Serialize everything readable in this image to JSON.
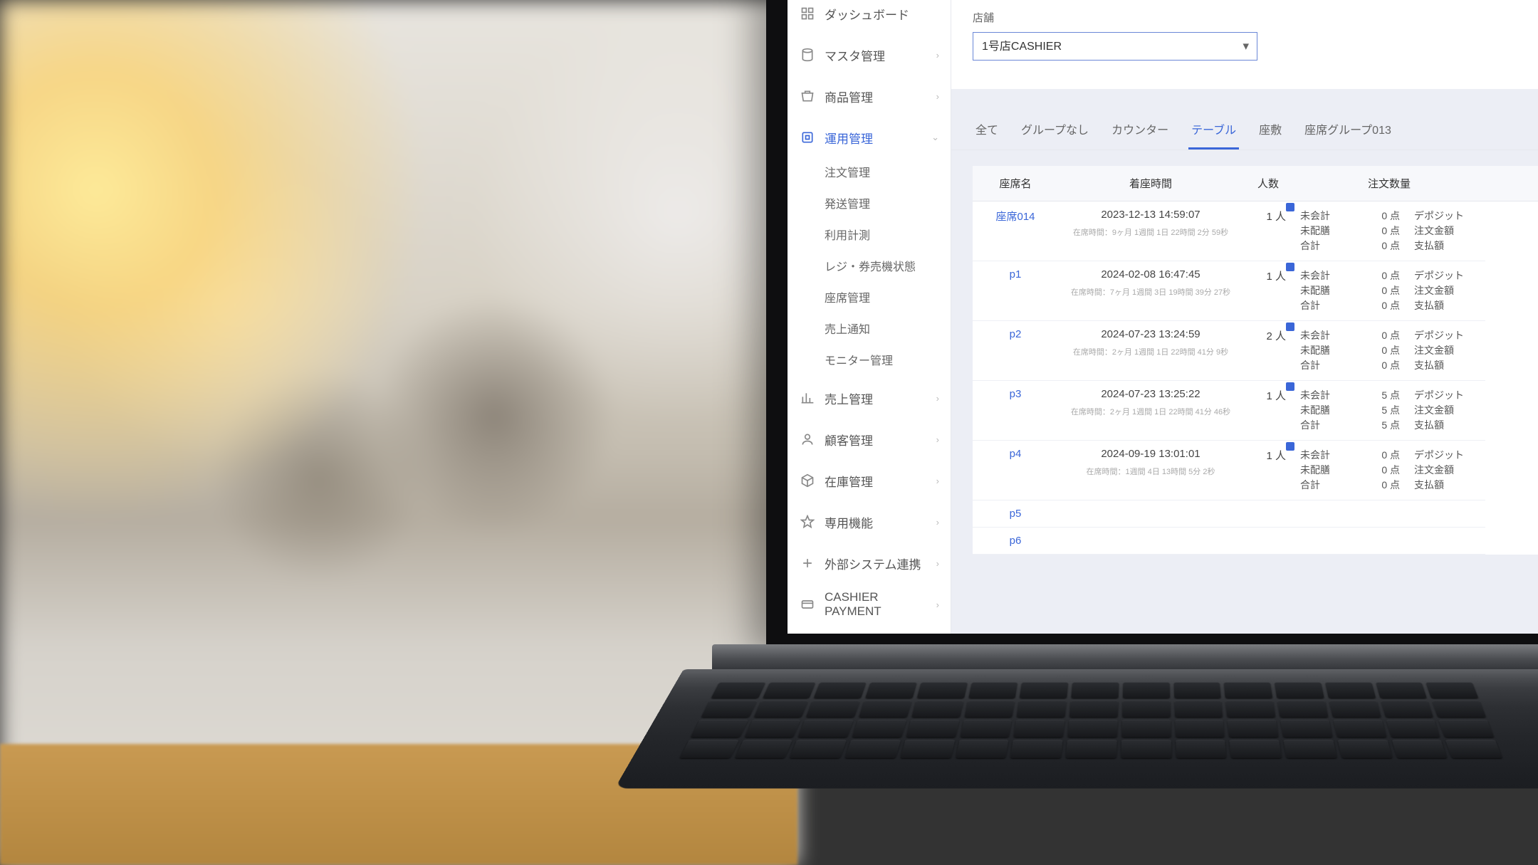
{
  "sidebar": {
    "items": [
      {
        "label": "ダッシュボード",
        "icon": "dashboard"
      },
      {
        "label": "マスタ管理",
        "icon": "master",
        "chev": true
      },
      {
        "label": "商品管理",
        "icon": "product",
        "chev": true
      },
      {
        "label": "運用管理",
        "icon": "operations",
        "chev": true,
        "active": true
      },
      {
        "label": "売上管理",
        "icon": "sales",
        "chev": true
      },
      {
        "label": "顧客管理",
        "icon": "customer",
        "chev": true
      },
      {
        "label": "在庫管理",
        "icon": "stock",
        "chev": true
      },
      {
        "label": "専用機能",
        "icon": "special",
        "chev": true
      },
      {
        "label": "外部システム連携",
        "icon": "external",
        "chev": true
      },
      {
        "label": "CASHIER PAYMENT",
        "icon": "payment",
        "chev": true
      }
    ],
    "operations_sub": [
      "注文管理",
      "発送管理",
      "利用計測",
      "レジ・券売機状態",
      "座席管理",
      "売上通知",
      "モニター管理"
    ]
  },
  "filter": {
    "label": "店舗",
    "selected": "1号店CASHIER"
  },
  "tabs": [
    "全て",
    "グループなし",
    "カウンター",
    "テーブル",
    "座敷",
    "座席グループ013"
  ],
  "active_tab": "テーブル",
  "table": {
    "headers": {
      "seat": "座席名",
      "seated_at": "着座時間",
      "people": "人数",
      "orders": "注文数量"
    },
    "order_labels": {
      "unpaid": "未会計",
      "undelivered": "未配膳",
      "total": "合計"
    },
    "unit": "点",
    "extra_labels": {
      "deposit": "デポジット",
      "order_amount": "注文金額",
      "pay_amount": "支払額"
    },
    "rows": [
      {
        "seat": "座席014",
        "time": "2023-12-13 14:59:07",
        "elapsed": "在席時間：9ヶ月 1週間 1日 22時間 2分 59秒",
        "people": "1 人",
        "unpaid": "0",
        "undelivered": "0",
        "total": "0"
      },
      {
        "seat": "p1",
        "time": "2024-02-08 16:47:45",
        "elapsed": "在席時間：7ヶ月 1週間 3日 19時間 39分 27秒",
        "people": "1 人",
        "unpaid": "0",
        "undelivered": "0",
        "total": "0"
      },
      {
        "seat": "p2",
        "time": "2024-07-23 13:24:59",
        "elapsed": "在席時間：2ヶ月 1週間 1日 22時間 41分 9秒",
        "people": "2 人",
        "unpaid": "0",
        "undelivered": "0",
        "total": "0"
      },
      {
        "seat": "p3",
        "time": "2024-07-23 13:25:22",
        "elapsed": "在席時間：2ヶ月 1週間 1日 22時間 41分 46秒",
        "people": "1 人",
        "unpaid": "5",
        "undelivered": "5",
        "total": "5"
      },
      {
        "seat": "p4",
        "time": "2024-09-19 13:01:01",
        "elapsed": "在席時間：1週間 4日 13時間 5分 2秒",
        "people": "1 人",
        "unpaid": "0",
        "undelivered": "0",
        "total": "0"
      },
      {
        "seat": "p5"
      },
      {
        "seat": "p6"
      }
    ]
  }
}
